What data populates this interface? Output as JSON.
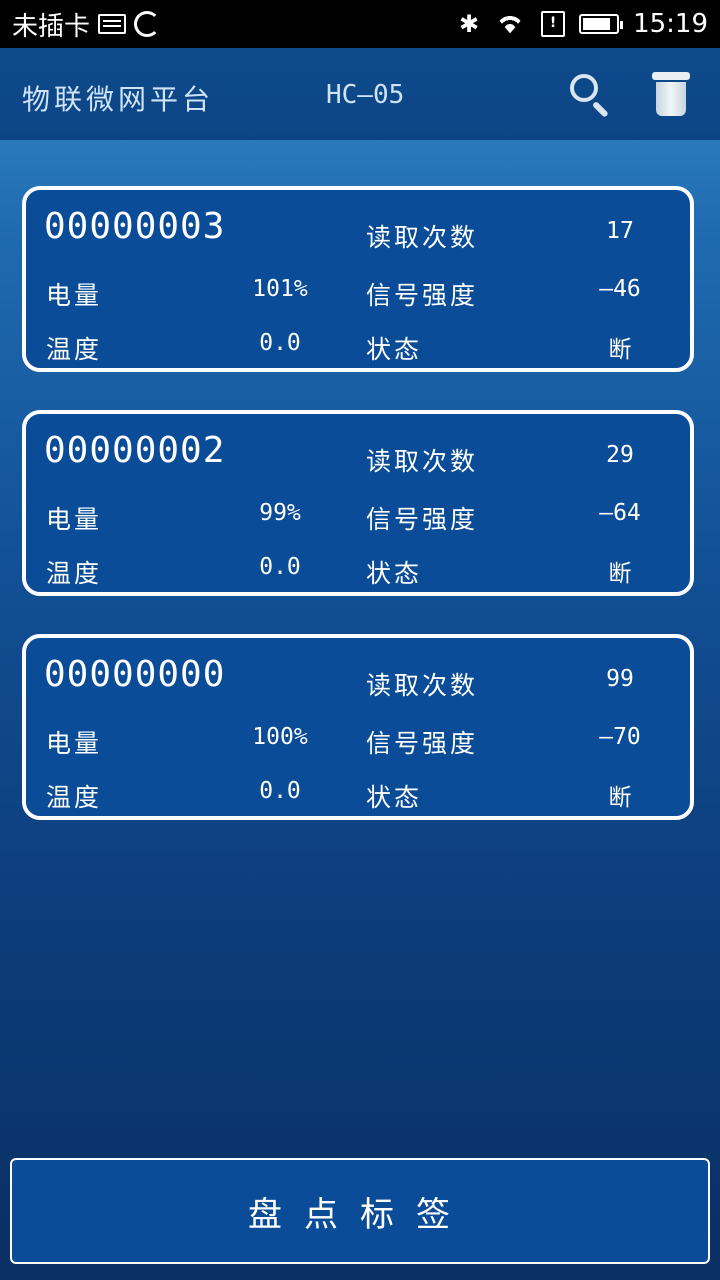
{
  "status_bar": {
    "carrier": "未插卡",
    "time": "15:19",
    "icons": [
      "keyboard-icon",
      "sync-icon",
      "bluetooth-icon",
      "wifi-icon",
      "sim-alert-icon",
      "battery-icon"
    ],
    "battery_level": 0.85
  },
  "app_bar": {
    "title": "物联微网平台",
    "device": "HC—05",
    "icons": [
      "search-icon",
      "trash-icon"
    ]
  },
  "labels": {
    "read_count": "读取次数",
    "battery": "电量",
    "signal": "信号强度",
    "temperature": "温度",
    "status": "状态"
  },
  "tags": [
    {
      "id": "00000003",
      "read_count": "17",
      "battery": "101%",
      "signal": "—46",
      "temperature": "0.0",
      "status": "断"
    },
    {
      "id": "00000002",
      "read_count": "29",
      "battery": "99%",
      "signal": "—64",
      "temperature": "0.0",
      "status": "断"
    },
    {
      "id": "00000000",
      "read_count": "99",
      "battery": "100%",
      "signal": "—70",
      "temperature": "0.0",
      "status": "断"
    }
  ],
  "inventory_button": {
    "label": "盘点标签"
  },
  "colors": {
    "card_bg": "#0b4c98",
    "appbar_bg": "#0e4a8c",
    "border": "#ffffff"
  }
}
